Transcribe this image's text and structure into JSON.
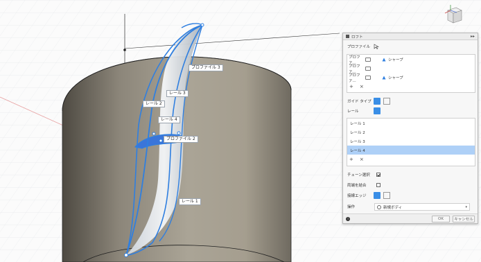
{
  "viewport": {
    "labels": {
      "profile3": "プロファイル 3",
      "rail3": "レール 3",
      "rail2": "レール 2",
      "rail4": "レール 4",
      "profile2": "プロファイル 2",
      "rail1": "レール 1"
    }
  },
  "panel": {
    "title": "ロフト",
    "expand_icon": "▸▸",
    "profile_label": "プロファイル",
    "profiles": [
      {
        "name": "プロファ...",
        "sharp": "シャープ"
      },
      {
        "name": "プロファ...",
        "sharp": ""
      },
      {
        "name": "プロファ...",
        "sharp": "シャープ"
      }
    ],
    "guide_type_label": "ガイド タイプ",
    "rail_label": "レール",
    "rails": [
      "レール 1",
      "レール 2",
      "レール 3",
      "レール 4"
    ],
    "selected_rail_index": 3,
    "chain_select_label": "チェーン選択",
    "chain_select_checked": true,
    "closed_label": "両端を結合",
    "closed_checked": false,
    "tangent_edges_label": "接線エッジ",
    "operation_label": "操作",
    "operation_value": "新規ボディ",
    "add_symbol": "+",
    "remove_symbol": "×",
    "ok_label": "OK",
    "cancel_label": "キャンセル",
    "info_symbol": "i",
    "colors": {
      "accent": "#3a8ee6",
      "selection": "#aed0f7",
      "curve": "#2f7fe0"
    }
  }
}
